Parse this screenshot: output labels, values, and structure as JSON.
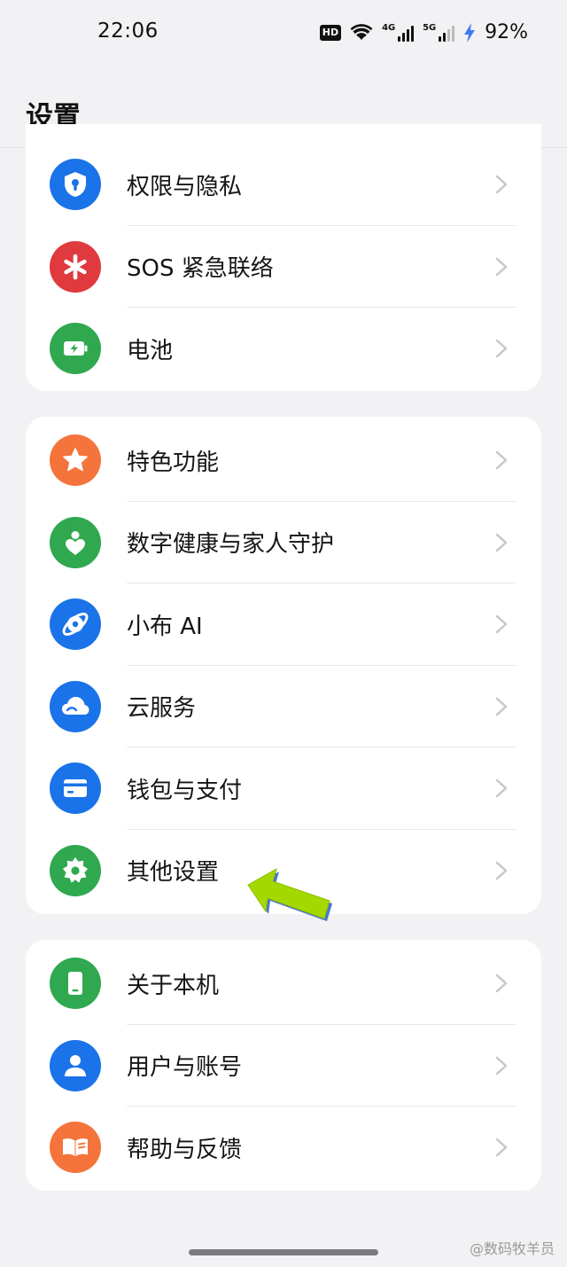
{
  "status_bar": {
    "time": "22:06",
    "hd": "HD",
    "net1": "4G",
    "net2": "5G",
    "battery": "92%"
  },
  "header": {
    "title": "设置"
  },
  "groups": [
    {
      "items": [
        {
          "label": "权限与隐私",
          "icon": "shield-lock-icon",
          "color": "#1a73e8"
        },
        {
          "label": "SOS 紧急联络",
          "icon": "asterisk-icon",
          "color": "#e0393e"
        },
        {
          "label": "电池",
          "icon": "battery-icon",
          "color": "#2fa84f"
        }
      ]
    },
    {
      "items": [
        {
          "label": "特色功能",
          "icon": "star-icon",
          "color": "#f4743b"
        },
        {
          "label": "数字健康与家人守护",
          "icon": "wellbeing-icon",
          "color": "#2fa84f"
        },
        {
          "label": "小布 AI",
          "icon": "ai-assistant-icon",
          "color": "#1a73e8"
        },
        {
          "label": "云服务",
          "icon": "cloud-icon",
          "color": "#1a73e8"
        },
        {
          "label": "钱包与支付",
          "icon": "wallet-icon",
          "color": "#1a73e8"
        },
        {
          "label": "其他设置",
          "icon": "gear-icon",
          "color": "#2fa84f"
        }
      ]
    },
    {
      "items": [
        {
          "label": "关于本机",
          "icon": "phone-icon",
          "color": "#2fa84f"
        },
        {
          "label": "用户与账号",
          "icon": "user-icon",
          "color": "#1a73e8"
        },
        {
          "label": "帮助与反馈",
          "icon": "book-icon",
          "color": "#f4743b"
        }
      ]
    }
  ],
  "watermark": "@数码牧羊员",
  "annotation": {
    "icon": "green-arrow-icon",
    "color": "#a3d900"
  }
}
